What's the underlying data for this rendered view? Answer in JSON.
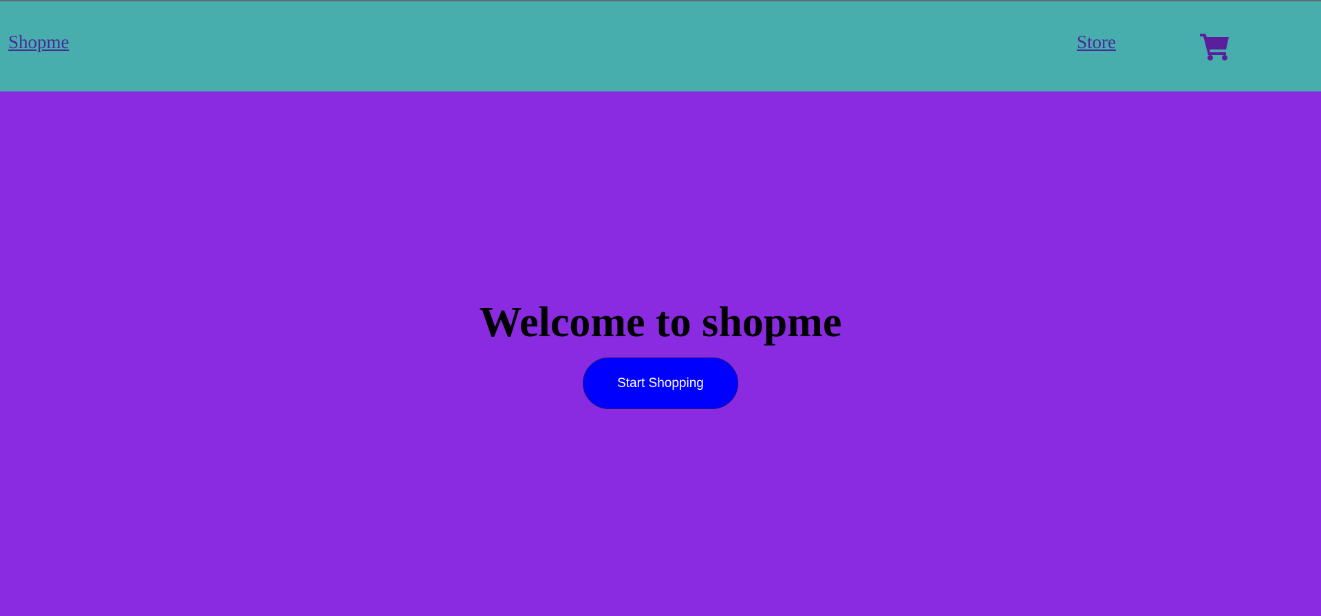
{
  "navbar": {
    "brand": "Shopme",
    "store_link": "Store",
    "cart_icon": "shopping-cart-icon"
  },
  "hero": {
    "title": "Welcome to shopme",
    "cta_label": "Start Shopping"
  },
  "colors": {
    "navbar_bg": "#48adad",
    "page_bg": "#8a2be2",
    "link": "#4a2a9a",
    "cart_icon": "#5b1f9e",
    "cta_bg": "#0000ff",
    "cta_text": "#ffffff"
  }
}
